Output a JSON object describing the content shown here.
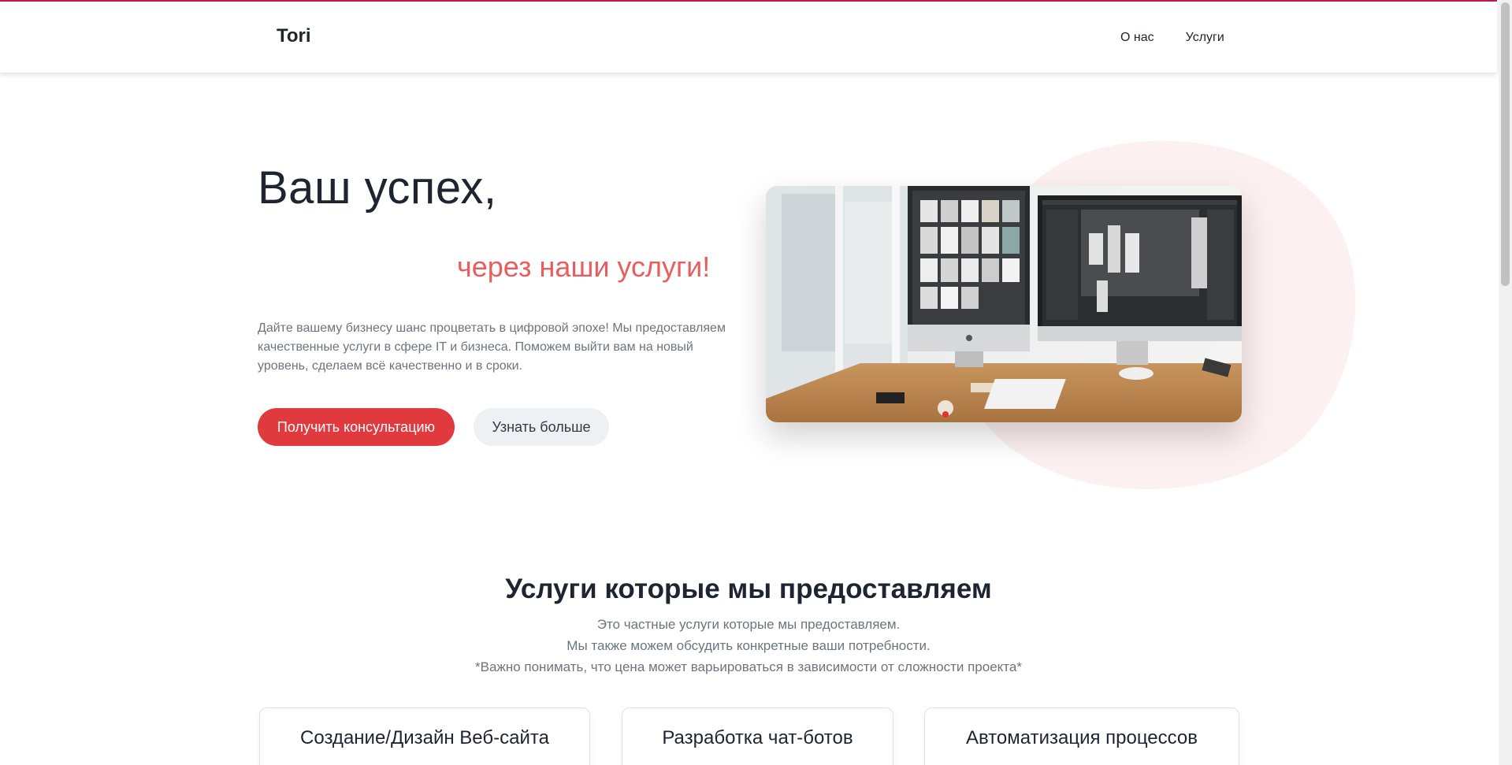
{
  "brand": "Tori",
  "nav": {
    "items": [
      "О нас",
      "Услуги"
    ]
  },
  "hero": {
    "title": "Ваш успех,",
    "subtitle": "через наши услуги!",
    "description": "Дайте вашему бизнесу шанс процветать в цифровой эпохе! Мы предоставляем качественные услуги в сфере IT и бизнеса. Поможем выйти вам на новый уровень, сделаем всё качественно и в сроки.",
    "primary_button": "Получить консультацию",
    "secondary_button": "Узнать больше"
  },
  "services": {
    "title": "Услуги которые мы предоставляем",
    "lines": [
      "Это частные услуги которые мы предоставляем.",
      "Мы также можем обсудить конкретные ваши потребности.",
      "*Важно понимать, что цена может варьироваться в зависимости от сложности проекта*"
    ],
    "cards": [
      {
        "title": "Создание/Дизайн Веб-сайта"
      },
      {
        "title": "Разработка чат-ботов"
      },
      {
        "title": "Автоматизация процессов"
      }
    ]
  },
  "colors": {
    "accent": "#e0393e",
    "subtitle": "#e85d5d",
    "top_border": "#c2185b",
    "blob": "#fdf0f0"
  }
}
